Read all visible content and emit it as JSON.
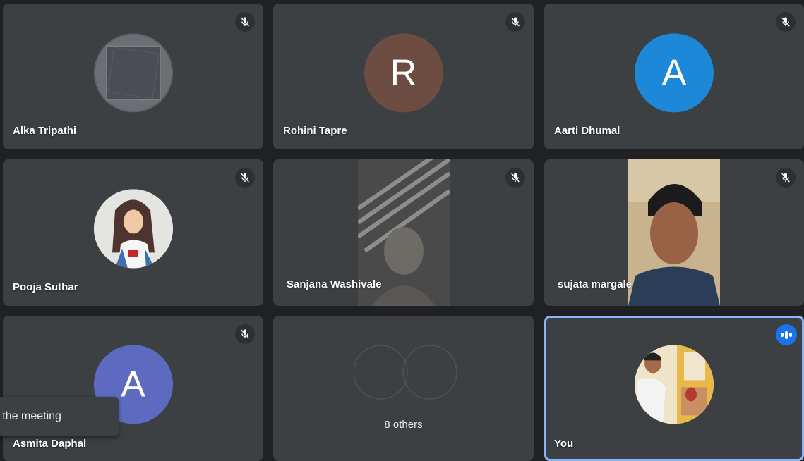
{
  "participants": [
    {
      "name": "Alka Tripathi",
      "muted": true
    },
    {
      "name": "Rohini Tapre",
      "initial": "R",
      "avatar_color": "#6d4c41",
      "muted": true
    },
    {
      "name": "Aarti Dhumal",
      "initial": "A",
      "avatar_color": "#1e88d8",
      "muted": true
    },
    {
      "name": "Pooja Suthar",
      "muted": true
    },
    {
      "name": "Sanjana Washivale",
      "muted": true
    },
    {
      "name": "sujata margale",
      "muted": true
    },
    {
      "name": "Asmita Daphal",
      "initial": "A",
      "avatar_color": "#5c6bc0",
      "muted": true
    },
    {
      "others_label": "8 others"
    },
    {
      "name": "You",
      "speaking": true
    }
  ],
  "toast": {
    "text": "ft the meeting"
  },
  "colors": {
    "tile": "#3c4043",
    "background": "#202124",
    "active_border": "#8ab4f8",
    "speaking": "#1a73e8"
  }
}
